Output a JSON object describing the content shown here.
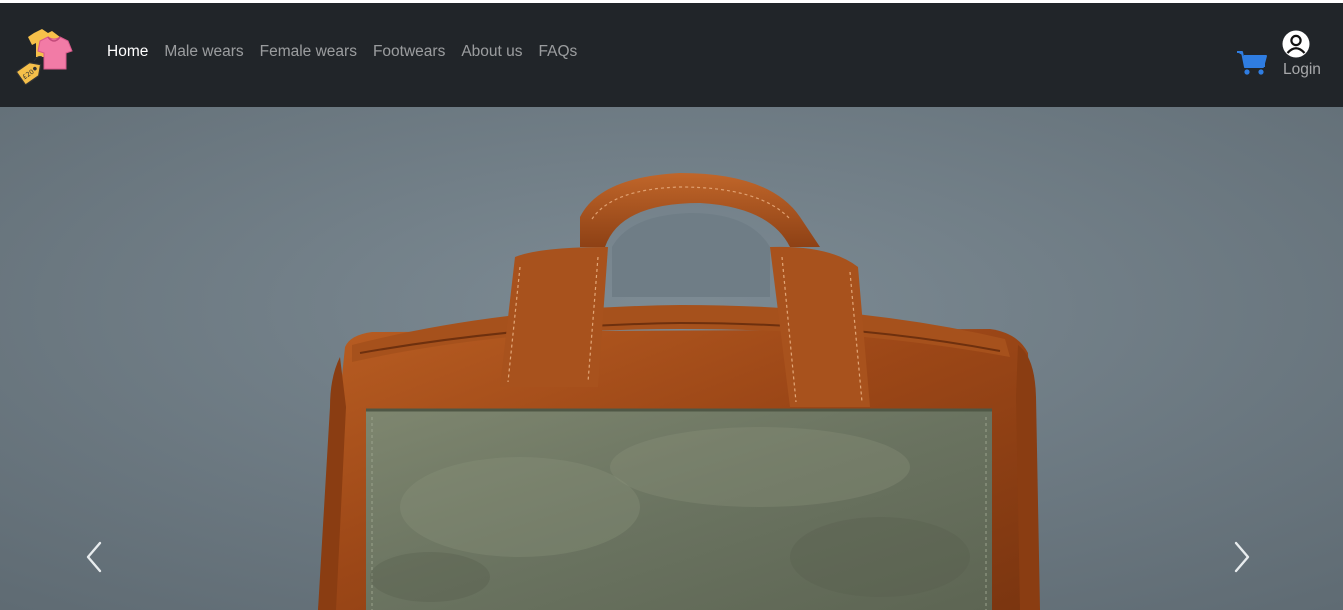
{
  "brand": {
    "logo_icon": "clothing-tag-logo-icon",
    "tag_text": "£20"
  },
  "nav": {
    "items": [
      {
        "label": "Home",
        "active": true
      },
      {
        "label": "Male wears",
        "active": false
      },
      {
        "label": "Female wears",
        "active": false
      },
      {
        "label": "Footwears",
        "active": false
      },
      {
        "label": "About us",
        "active": false
      },
      {
        "label": "FAQs",
        "active": false
      }
    ]
  },
  "actions": {
    "cart_icon": "shopping-cart-icon",
    "user_icon": "user-avatar-icon",
    "login_label": "Login"
  },
  "carousel": {
    "slide_subject": "leather-bag-photo",
    "prev_icon": "chevron-left-icon",
    "next_icon": "chevron-right-icon"
  },
  "colors": {
    "navbar_bg": "#212529",
    "nav_active": "#ffffff",
    "nav_inactive": "rgba(255,255,255,0.55)",
    "cart_blue": "#2f7de1",
    "backdrop_gray": "#6f7d86",
    "leather_brown": "#a4501d",
    "flap_green": "#6f7763"
  }
}
